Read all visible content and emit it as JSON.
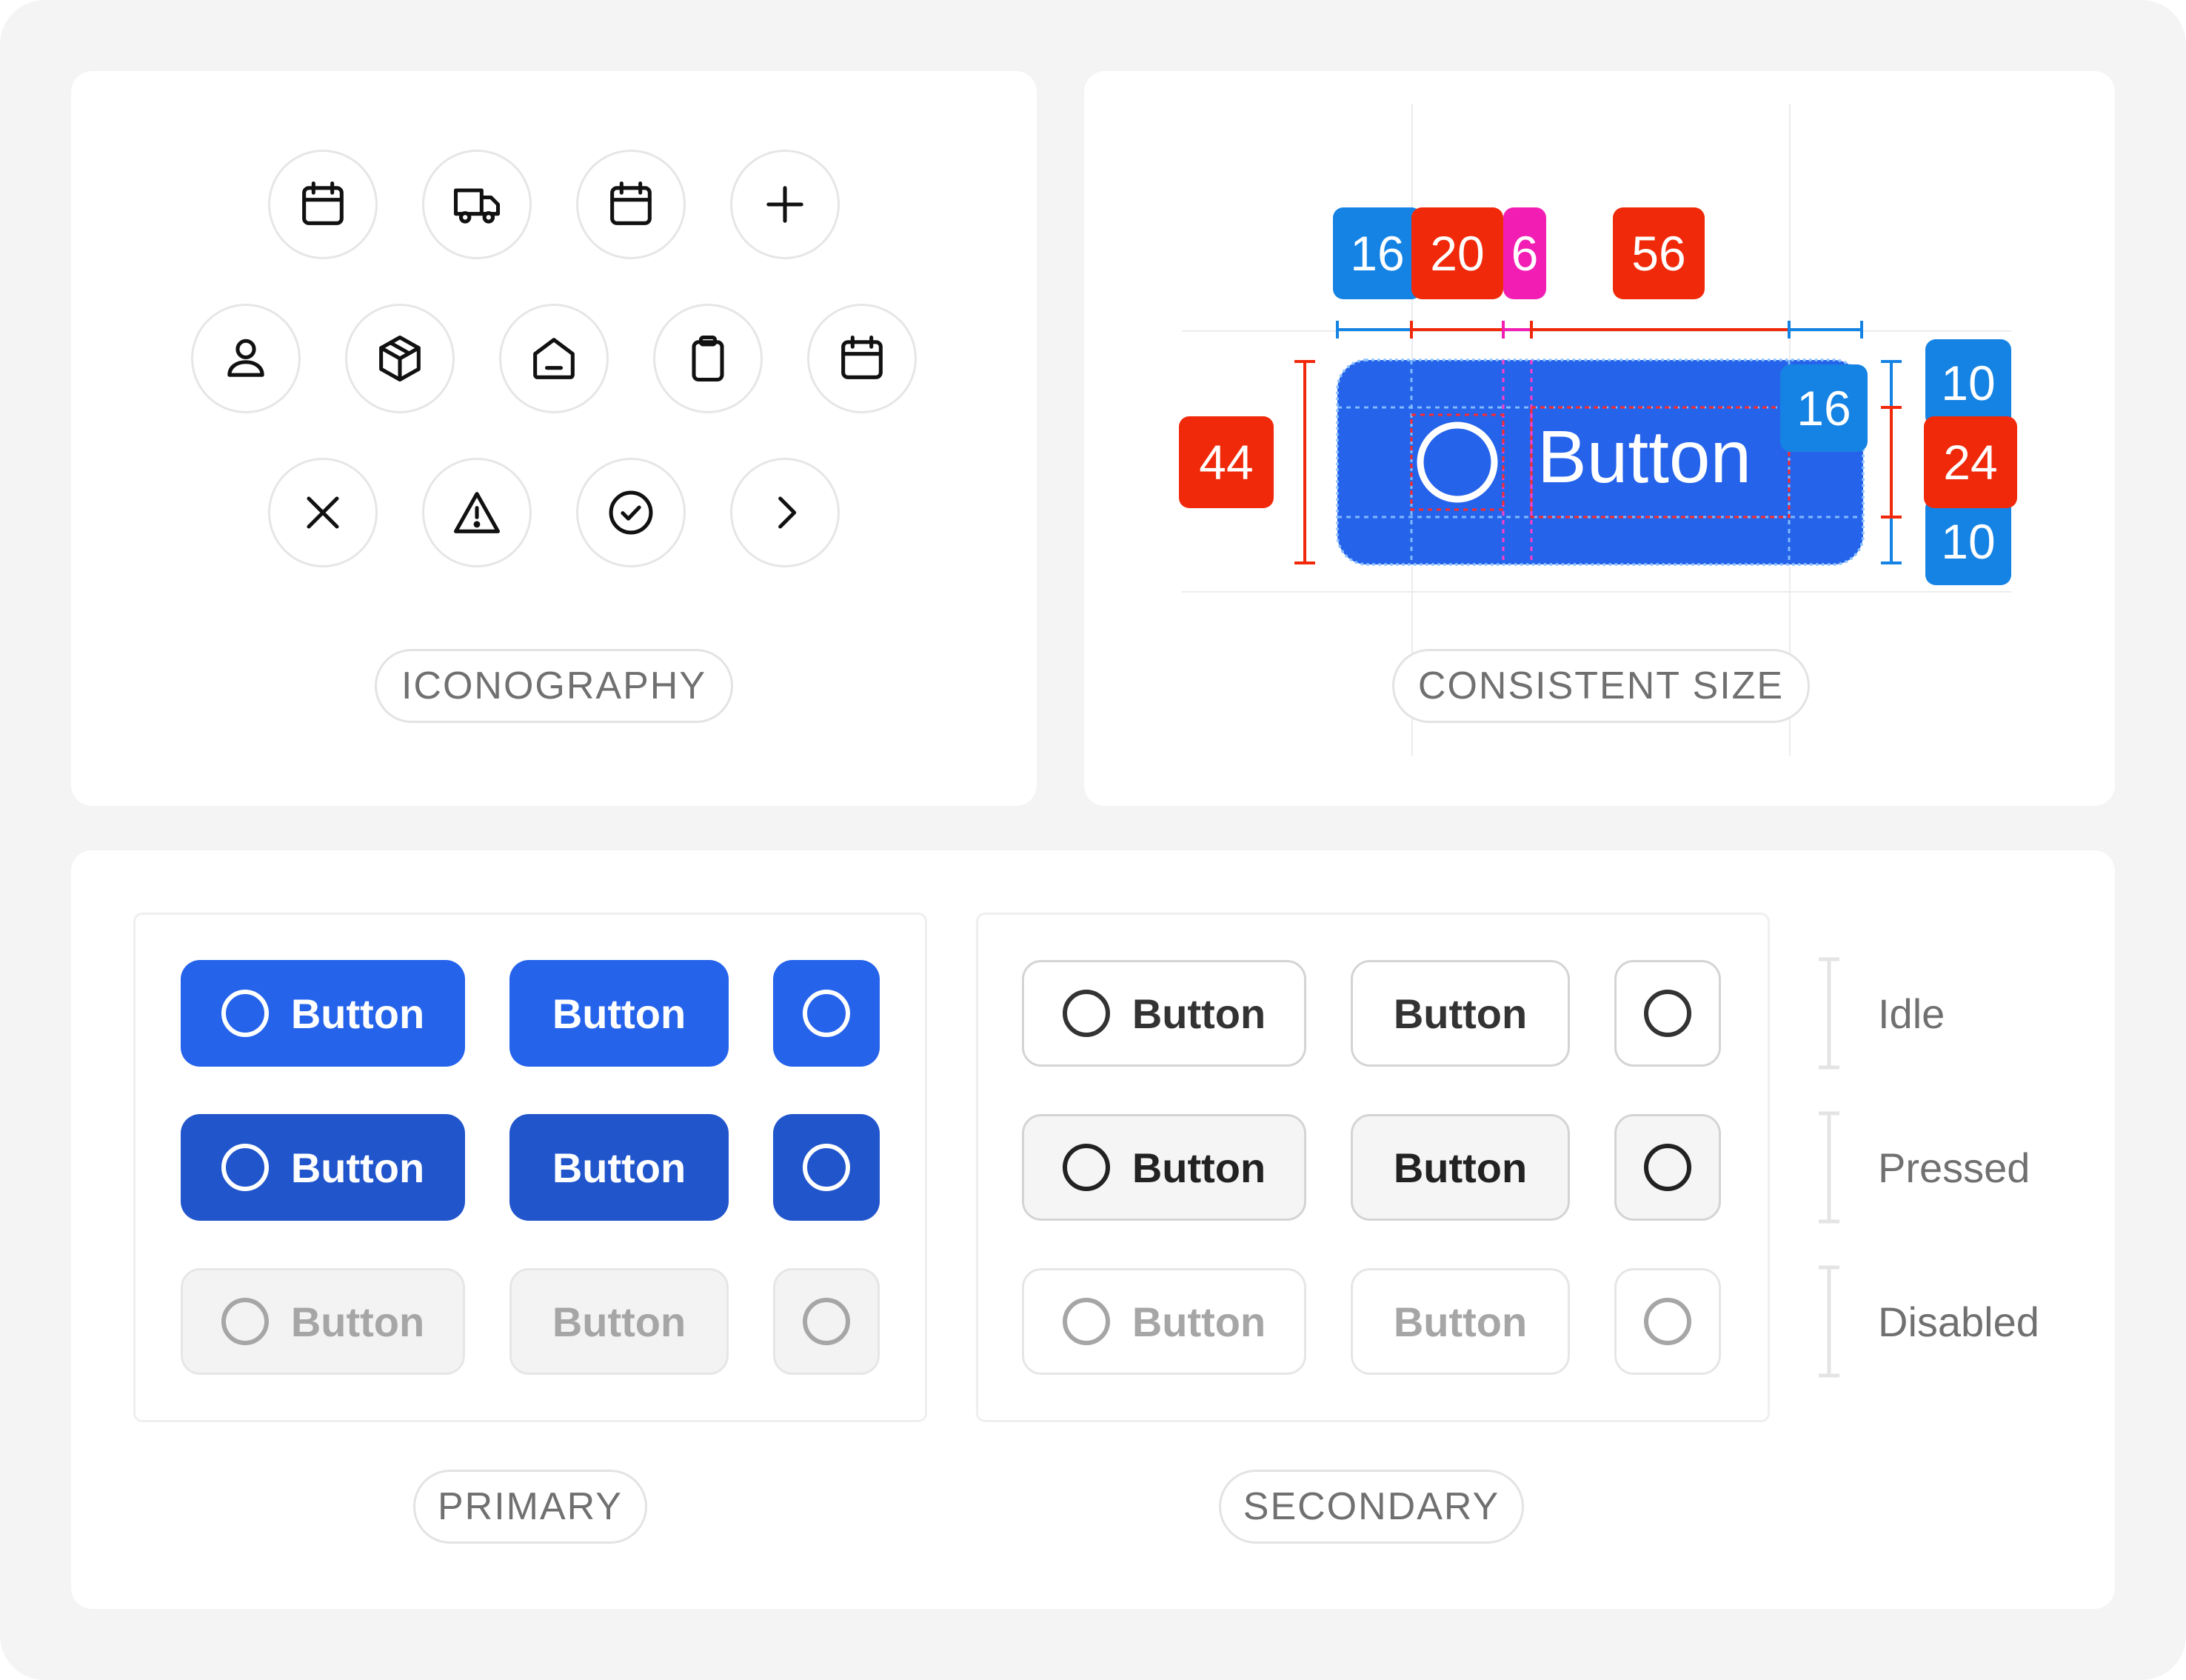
{
  "panels": {
    "iconography": {
      "label": "ICONOGRAPHY",
      "icons": [
        "calendar-icon",
        "truck-icon",
        "calendar-icon",
        "plus-icon",
        "user-icon",
        "box-icon",
        "home-icon",
        "clipboard-icon",
        "calendar-icon",
        "close-icon",
        "warning-icon",
        "check-circle-icon",
        "chevron-right-icon"
      ]
    },
    "consistent_size": {
      "label": "CONSISTENT SIZE",
      "button_label": "Button",
      "width_measures": [
        "16",
        "20",
        "6",
        "56",
        "16"
      ],
      "height_measures": [
        "44",
        "10",
        "24",
        "10"
      ]
    },
    "buttons": {
      "primary_label": "PRIMARY",
      "secondary_label": "SECONDARY",
      "button_label": "Button",
      "states": [
        "Idle",
        "Pressed",
        "Disabled"
      ]
    }
  },
  "colors": {
    "background": "#f4f4f4",
    "primary": "#2563eb",
    "primary_pressed": "#2155cc",
    "measure_blue": "#1583e4",
    "measure_red": "#f0290a",
    "measure_pink": "#f21eb4"
  }
}
